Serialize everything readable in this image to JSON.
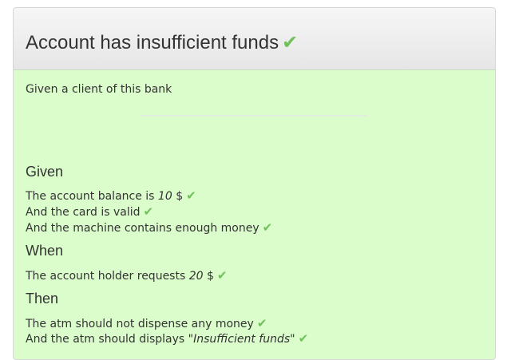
{
  "scenario": {
    "title": "Account has insufficient funds",
    "status_icon": "check-icon",
    "status_color": "#6fc15a",
    "description": "Given a client of this bank"
  },
  "sections": {
    "given": {
      "keyword": "Given",
      "steps": [
        {
          "before": "The account balance is ",
          "value": "10",
          "after": " $"
        },
        {
          "text": "And the card is valid"
        },
        {
          "text": "And the machine contains enough money"
        }
      ]
    },
    "when": {
      "keyword": "When",
      "steps": [
        {
          "before": "The account holder requests ",
          "value": "20",
          "after": " $"
        }
      ]
    },
    "then": {
      "keyword": "Then",
      "steps": [
        {
          "text": "The atm should not dispense any money"
        },
        {
          "before": "And the atm should displays \"",
          "value": "Insufficient funds",
          "after": "\""
        }
      ]
    }
  },
  "colors": {
    "passed_background": "#dbfdcc",
    "header_background": "#ececec",
    "check": "#6fc15a"
  }
}
